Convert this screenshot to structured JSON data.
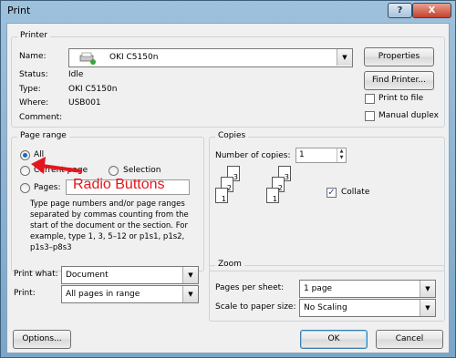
{
  "window": {
    "title": "Print",
    "help_label": "?",
    "close_label": "X"
  },
  "printer": {
    "group_label": "Printer",
    "name_label": "Name:",
    "name_value": "OKI C5150n",
    "status_label": "Status:",
    "status_value": "Idle",
    "type_label": "Type:",
    "type_value": "OKI C5150n",
    "where_label": "Where:",
    "where_value": "USB001",
    "comment_label": "Comment:",
    "comment_value": "",
    "properties_label": "Properties",
    "find_printer_label": "Find Printer...",
    "print_to_file_label": "Print to file",
    "manual_duplex_label": "Manual duplex",
    "printer_icon": "printer-icon"
  },
  "page_range": {
    "group_label": "Page range",
    "all_label": "All",
    "current_page_label": "Current page",
    "selection_label": "Selection",
    "pages_label": "Pages:",
    "pages_value": "",
    "help_text": "Type page numbers and/or page ranges separated by commas counting from the start of the document or the section. For example, type 1, 3, 5–12 or p1s1, p1s2, p1s3–p8s3"
  },
  "copies": {
    "group_label": "Copies",
    "number_label": "Number of copies:",
    "number_value": "1",
    "collate_label": "Collate",
    "collate_checked": true
  },
  "print_what": {
    "label": "Print what:",
    "value": "Document"
  },
  "print": {
    "label": "Print:",
    "value": "All pages in range"
  },
  "zoom": {
    "group_label": "Zoom",
    "pages_per_sheet_label": "Pages per sheet:",
    "pages_per_sheet_value": "1 page",
    "scale_label": "Scale to paper size:",
    "scale_value": "No Scaling"
  },
  "buttons": {
    "options": "Options...",
    "ok": "OK",
    "cancel": "Cancel"
  },
  "annotation": {
    "text": "Radio Buttons",
    "color": "#e3171d"
  }
}
